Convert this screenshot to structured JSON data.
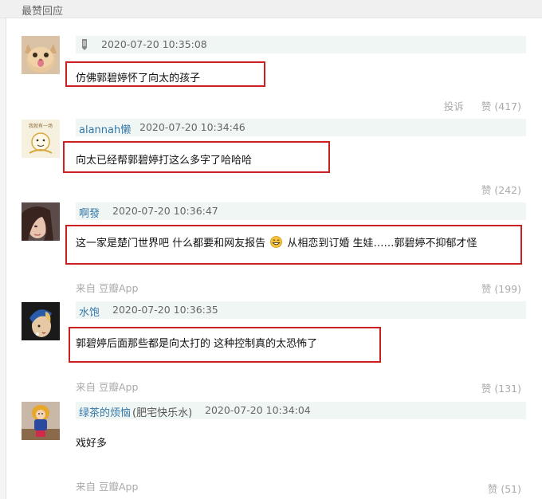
{
  "section": {
    "title": "最赞回应"
  },
  "comments": [
    {
      "author": "",
      "author_note": "",
      "timestamp": "2020-07-20 10:35:08",
      "text": "仿佛郭碧婷怀了向太的孩子",
      "text_after": "",
      "source": "",
      "report_label": "投诉",
      "likes": "赞 (417)",
      "avatar_icon": "cat-avatar-icon"
    },
    {
      "author": "alannah懒",
      "author_note": "",
      "timestamp": "2020-07-20 10:34:46",
      "text": "向太已经帮郭碧婷打这么多字了哈哈哈",
      "text_after": "",
      "source": "",
      "report_label": "",
      "likes": "赞 (242)",
      "avatar_text": "我就有一场",
      "avatar_icon": "cartoon-avatar-icon"
    },
    {
      "author": "啊發",
      "author_note": "",
      "timestamp": "2020-07-20 10:36:47",
      "text": "这一家是楚门世界吧 什么都要和网友报告",
      "text_after": "从相恋到订婚 生娃……郭碧婷不抑郁才怪",
      "source": "来自 豆瓣App",
      "report_label": "",
      "likes": "赞 (199)",
      "emoji_icon": "grinning-emoji-icon",
      "avatar_icon": "portrait-avatar-icon"
    },
    {
      "author": "水饱",
      "author_note": "",
      "timestamp": "2020-07-20 10:36:35",
      "text": "郭碧婷后面那些都是向太打的 这种控制真的太恐怖了",
      "text_after": "",
      "source": "来自 豆瓣App",
      "report_label": "",
      "likes": "赞 (131)",
      "avatar_icon": "pearl-earring-avatar-icon"
    },
    {
      "author": "绿茶的烦恼",
      "author_note": "(肥宅快乐水)",
      "timestamp": "2020-07-20 10:34:04",
      "text": "戏好多",
      "text_after": "",
      "source": "来自 豆瓣App",
      "report_label": "",
      "likes": "赞 (51)",
      "avatar_icon": "doll-avatar-icon"
    }
  ],
  "colors": {
    "highlight_border": "#cc1f1f",
    "author_link": "#3377aa",
    "meta_bar": "#f0f6f3"
  }
}
